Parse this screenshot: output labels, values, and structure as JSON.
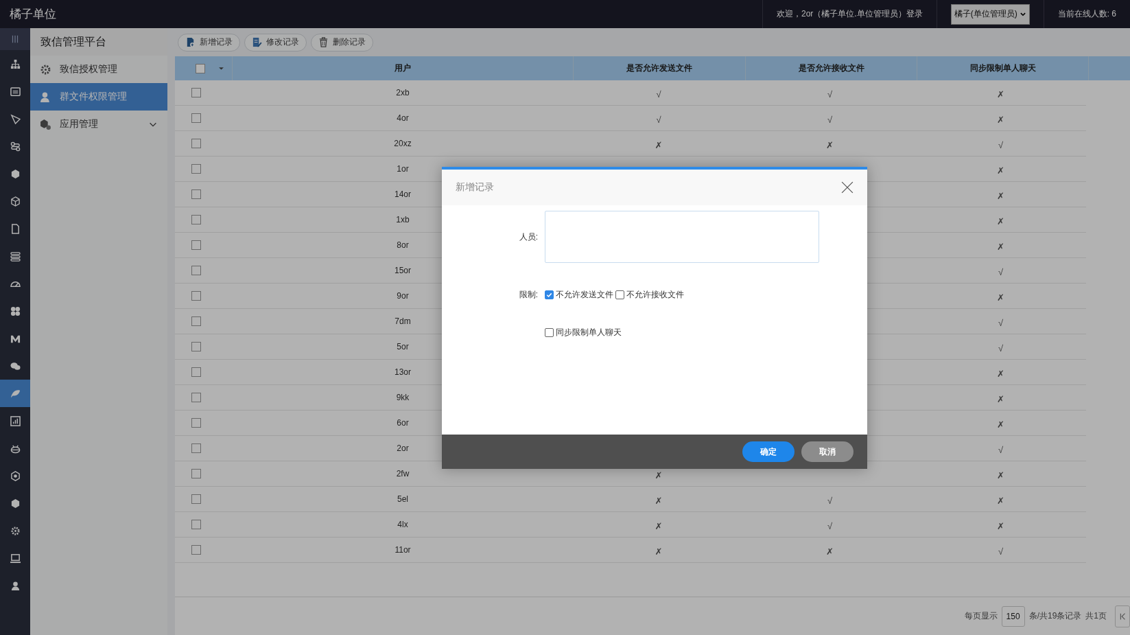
{
  "topbar": {
    "title": "橘子单位",
    "welcome": "欢迎，2or（橘子单位.单位管理员）登录",
    "role_select": "橘子(单位管理员)",
    "online": "当前在线人数: 6"
  },
  "rail": [
    {
      "selected": false
    },
    {
      "selected": false
    },
    {
      "selected": false
    },
    {
      "selected": false
    },
    {
      "selected": false
    },
    {
      "selected": false
    },
    {
      "selected": false
    },
    {
      "selected": false
    },
    {
      "selected": false
    },
    {
      "selected": false
    },
    {
      "selected": false
    },
    {
      "selected": false
    },
    {
      "selected": true
    },
    {
      "selected": false
    },
    {
      "selected": false
    },
    {
      "selected": false
    },
    {
      "selected": false
    },
    {
      "selected": false
    },
    {
      "selected": false
    },
    {
      "selected": false
    }
  ],
  "sidebar": {
    "title": "致信管理平台",
    "items": [
      {
        "label": "致信授权管理",
        "kind": "link",
        "selected": false
      },
      {
        "label": "群文件权限管理",
        "kind": "link",
        "selected": true
      },
      {
        "label": "应用管理",
        "kind": "group",
        "selected": false
      }
    ]
  },
  "toolbar": [
    {
      "label": "新增记录",
      "kind": "add"
    },
    {
      "label": "修改记录",
      "kind": "edit"
    },
    {
      "label": "删除记录",
      "kind": "delete"
    }
  ],
  "table": {
    "header_checked": false,
    "columns": [
      "用户",
      "是否允许发送文件",
      "是否允许接收文件",
      "同步限制单人聊天"
    ],
    "rows": [
      {
        "checked": false,
        "cells": [
          "2xb",
          "√",
          "√",
          "✗"
        ]
      },
      {
        "checked": false,
        "cells": [
          "4or",
          "√",
          "√",
          "✗"
        ]
      },
      {
        "checked": false,
        "cells": [
          "20xz",
          "✗",
          "✗",
          "√"
        ]
      },
      {
        "checked": false,
        "cells": [
          "1or",
          null,
          null,
          "✗"
        ]
      },
      {
        "checked": false,
        "cells": [
          "14or",
          null,
          null,
          "✗"
        ]
      },
      {
        "checked": false,
        "cells": [
          "1xb",
          null,
          null,
          "✗"
        ]
      },
      {
        "checked": false,
        "cells": [
          "8or",
          null,
          null,
          "✗"
        ]
      },
      {
        "checked": false,
        "cells": [
          "15or",
          null,
          null,
          "√"
        ]
      },
      {
        "checked": false,
        "cells": [
          "9or",
          null,
          null,
          "✗"
        ]
      },
      {
        "checked": false,
        "cells": [
          "7dm",
          null,
          null,
          "√"
        ]
      },
      {
        "checked": false,
        "cells": [
          "5or",
          null,
          null,
          "√"
        ]
      },
      {
        "checked": false,
        "cells": [
          "13or",
          null,
          null,
          "✗"
        ]
      },
      {
        "checked": false,
        "cells": [
          "9kk",
          null,
          null,
          "✗"
        ]
      },
      {
        "checked": false,
        "cells": [
          "6or",
          null,
          null,
          "✗"
        ]
      },
      {
        "checked": false,
        "cells": [
          "2or",
          null,
          null,
          "√"
        ]
      },
      {
        "checked": false,
        "cells": [
          "2fw",
          "✗",
          null,
          "✗"
        ]
      },
      {
        "checked": false,
        "cells": [
          "5el",
          "✗",
          "√",
          "✗"
        ]
      },
      {
        "checked": false,
        "cells": [
          "4lx",
          "✗",
          "√",
          "✗"
        ]
      },
      {
        "checked": false,
        "cells": [
          "11or",
          "✗",
          "✗",
          "√"
        ]
      }
    ]
  },
  "pagination": {
    "per_page_label": "每页显示",
    "per_page": "150",
    "total": "条/共19条记录",
    "pages": "共1页"
  },
  "dialog": {
    "title": "新增记录",
    "person_label": "人员:",
    "limit_label": "限制:",
    "options": [
      {
        "label": "不允许发送文件",
        "checked": true
      },
      {
        "label": "不允许接收文件",
        "checked": false
      },
      {
        "label": "同步限制单人聊天",
        "checked": false
      }
    ],
    "buttons": [
      {
        "label": "确定",
        "kind": "primary"
      },
      {
        "label": "取消",
        "kind": "secondary"
      }
    ]
  }
}
